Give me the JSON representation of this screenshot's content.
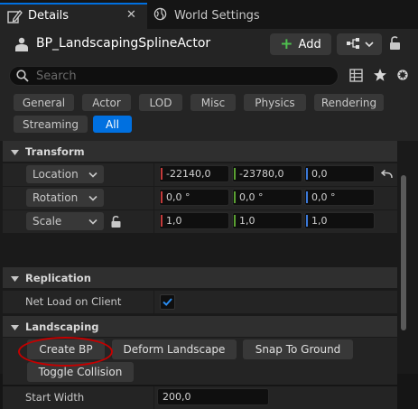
{
  "tabs": {
    "details": {
      "label": "Details",
      "close": "✕"
    },
    "world_settings": {
      "label": "World Settings"
    }
  },
  "header": {
    "actor_name": "BP_LandscapingSplineActor",
    "add_label": "Add"
  },
  "search": {
    "placeholder": "Search",
    "value": ""
  },
  "filters": [
    "General",
    "Actor",
    "LOD",
    "Misc",
    "Physics",
    "Rendering",
    "Streaming",
    "All"
  ],
  "active_filter": "All",
  "sections": {
    "transform": {
      "label": "Transform",
      "rows": [
        {
          "label": "Location",
          "x": "-22140,0",
          "y": "-23780,0",
          "z": "0,0"
        },
        {
          "label": "Rotation",
          "x": "0,0 °",
          "y": "0,0 °",
          "z": "0,0 °"
        },
        {
          "label": "Scale",
          "x": "1,0",
          "y": "1,0",
          "z": "1,0"
        }
      ]
    },
    "replication": {
      "label": "Replication",
      "net_load_label": "Net Load on Client",
      "net_load_checked": true
    },
    "landscaping": {
      "label": "Landscaping",
      "buttons": {
        "create_bp": "Create BP",
        "deform_landscape": "Deform Landscape",
        "snap_to_ground": "Snap To Ground",
        "toggle_collision": "Toggle Collision"
      },
      "start_width_label": "Start Width",
      "start_width_value": "200,0"
    }
  },
  "colors": {
    "accent": "#0070e0",
    "axis_x": "#c43a3a",
    "axis_y": "#5aa032",
    "axis_z": "#3a78d8",
    "highlight": "#c40000"
  }
}
